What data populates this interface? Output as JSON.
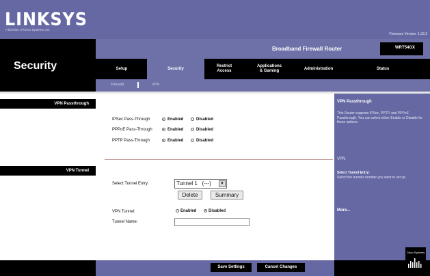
{
  "header": {
    "logo": "LINKSYS",
    "logo_sub": "A Division of Cisco Systems, Inc.",
    "firmware": "Firmware Version: 1.33.2"
  },
  "left": {
    "section_title": "Security",
    "sections": [
      "VPN Passthrough",
      "VPN Tunnel"
    ]
  },
  "product": {
    "name": "Broadband Firewall Router",
    "model": "WRT54GX"
  },
  "nav": {
    "items": [
      {
        "label": "Setup"
      },
      {
        "label": "Security"
      },
      {
        "label": "Restrict\nAccess"
      },
      {
        "label": "Applications\n& Gaming"
      },
      {
        "label": "Administration"
      },
      {
        "label": "Status"
      }
    ],
    "active": "Security",
    "sub_items": [
      "Firewall",
      "VPN"
    ]
  },
  "passthrough": {
    "rows": [
      {
        "label": "IPSec Pass-Through",
        "enabled_label": "Enabled",
        "disabled_label": "Disabled",
        "value": "Enabled"
      },
      {
        "label": "PPPoE Pass-Through",
        "enabled_label": "Enabled",
        "disabled_label": "Disabled",
        "value": "Enabled"
      },
      {
        "label": "PPTP Pass-Through",
        "enabled_label": "Enabled",
        "disabled_label": "Disabled",
        "value": "Enabled"
      }
    ]
  },
  "tunnel": {
    "select_label": "Select Tunnel Entry:",
    "select_value": "Tunnel 1   (---)",
    "delete_label": "Delete",
    "summary_label": "Summary",
    "vpn_tunnel_label": "VPN Tunnel:",
    "enabled_label": "Enabled",
    "disabled_label": "Disabled",
    "vpn_tunnel_value": "Disabled",
    "tunnel_name_label": "Tunnel Name:",
    "tunnel_name_value": ""
  },
  "help": {
    "title1": "VPN Passthrough",
    "body1": "This Router supports IPSec, PPTP, and PPPoE Passthrough. You can select either Enable or Disable for these options.",
    "title2": "VPN",
    "body2_bold": "Select Tunnel Entry:",
    "body2": "Select the tunnels number you want to set up.",
    "more": "More..."
  },
  "footer": {
    "save_label": "Save Settings",
    "cancel_label": "Cancel Changes",
    "cisco_label": "Cisco Systems"
  },
  "colors": {
    "brand": "#6668a3",
    "nav_black": "#000000"
  }
}
